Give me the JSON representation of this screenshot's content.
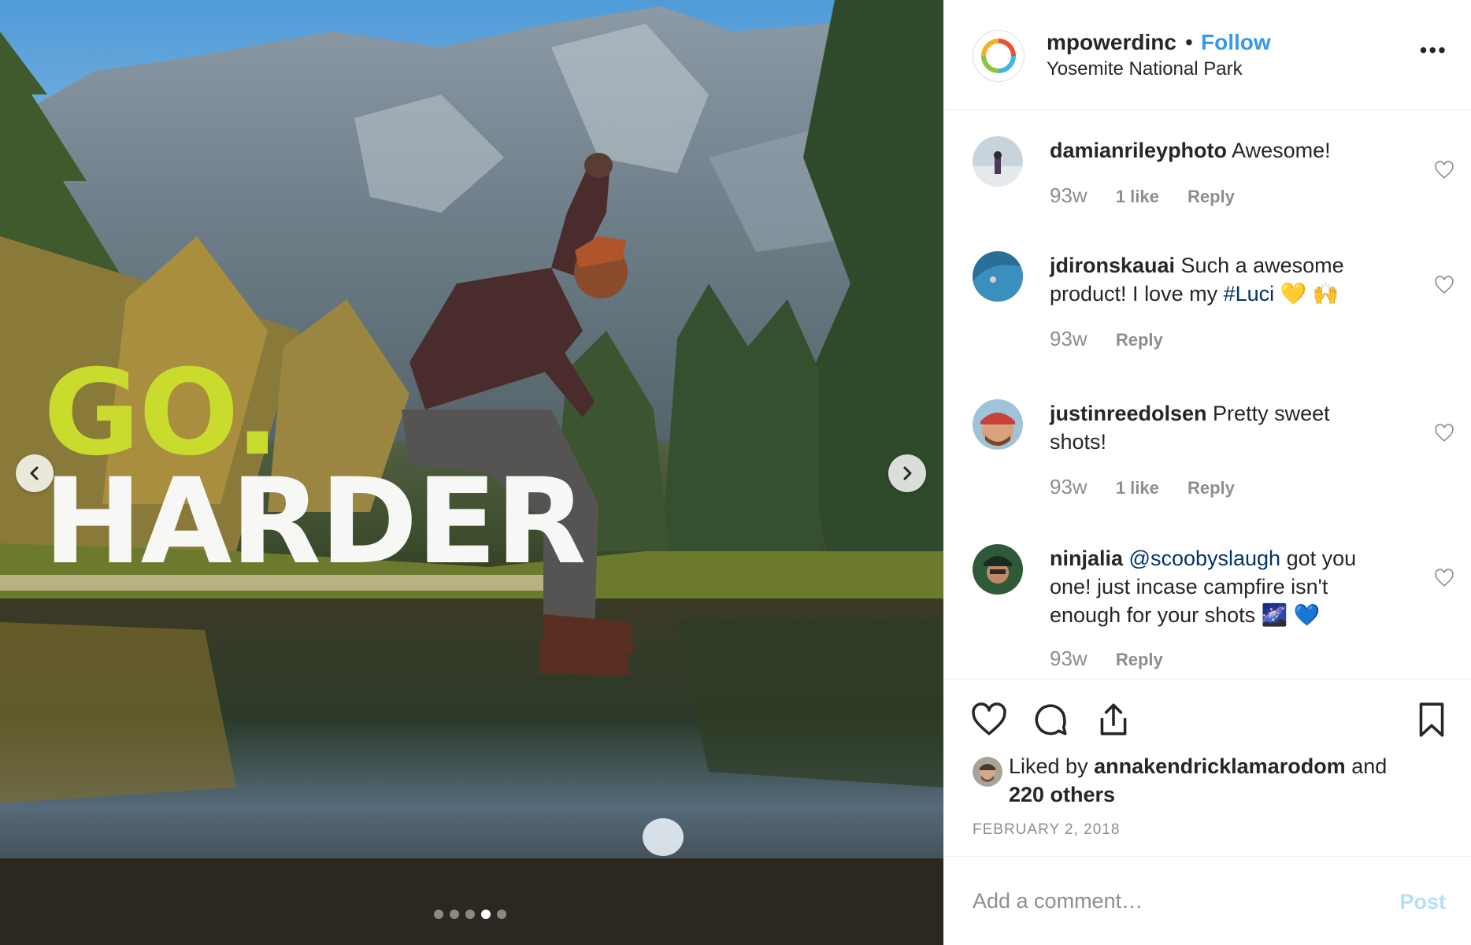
{
  "post": {
    "headline_line1": "GO.",
    "headline_line2": "HARDER",
    "carousel_total": 5,
    "carousel_active": 4
  },
  "header": {
    "username": "mpowerdinc",
    "separator": "•",
    "follow_label": "Follow",
    "location": "Yosemite National Park",
    "more_label": "•••"
  },
  "comments": [
    {
      "user": "damianrileyphoto",
      "text": " Awesome!",
      "time": "93w",
      "likes": "1 like",
      "reply": "Reply"
    },
    {
      "user": "jdironskauai",
      "text": " Such a awesome product! I love my ",
      "tag": "#Luci",
      "text_after": " 💛 🙌",
      "time": "93w",
      "reply": "Reply"
    },
    {
      "user": "justinreedolsen",
      "text": " Pretty sweet shots!",
      "time": "93w",
      "likes": "1 like",
      "reply": "Reply"
    },
    {
      "user": "ninjalia",
      "tag": "@scoobyslaugh",
      "text_before": " ",
      "text": " got you one! just incase campfire isn't enough for your shots 🌌 💙",
      "time": "93w",
      "reply": "Reply"
    }
  ],
  "likes": {
    "prefix": "Liked by ",
    "user": "annakendricklamarodom",
    "middle": " and",
    "others": "220 others"
  },
  "date": "FEBRUARY 2, 2018",
  "add_comment": {
    "placeholder": "Add a comment…",
    "post_label": "Post"
  },
  "icons": {
    "like": "heart-icon",
    "comment": "comment-bubble-icon",
    "share": "share-icon",
    "save": "bookmark-icon"
  },
  "colors": {
    "follow": "#3897f0",
    "post_disabled": "#b2dffc",
    "headline_green": "#c9dc2e",
    "muted": "#8e8e8e"
  }
}
